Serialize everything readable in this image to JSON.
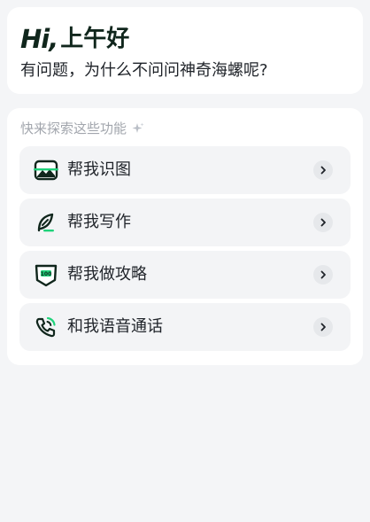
{
  "greeting": {
    "hi": "Hi,",
    "salutation": "上午好",
    "subtitle": "有问题，为什么不问问神奇海螺呢?"
  },
  "features": {
    "title": "快来探索这些功能",
    "items": [
      {
        "label": "帮我识图",
        "icon": "image-scan-icon"
      },
      {
        "label": "帮我写作",
        "icon": "feather-pen-icon"
      },
      {
        "label": "帮我做攻略",
        "icon": "score-shield-icon"
      },
      {
        "label": "和我语音通话",
        "icon": "phone-call-icon"
      }
    ]
  },
  "colors": {
    "accent": "#1fd27a",
    "background": "#f4f5f7",
    "card": "#ffffff",
    "item": "#f3f4f6"
  }
}
